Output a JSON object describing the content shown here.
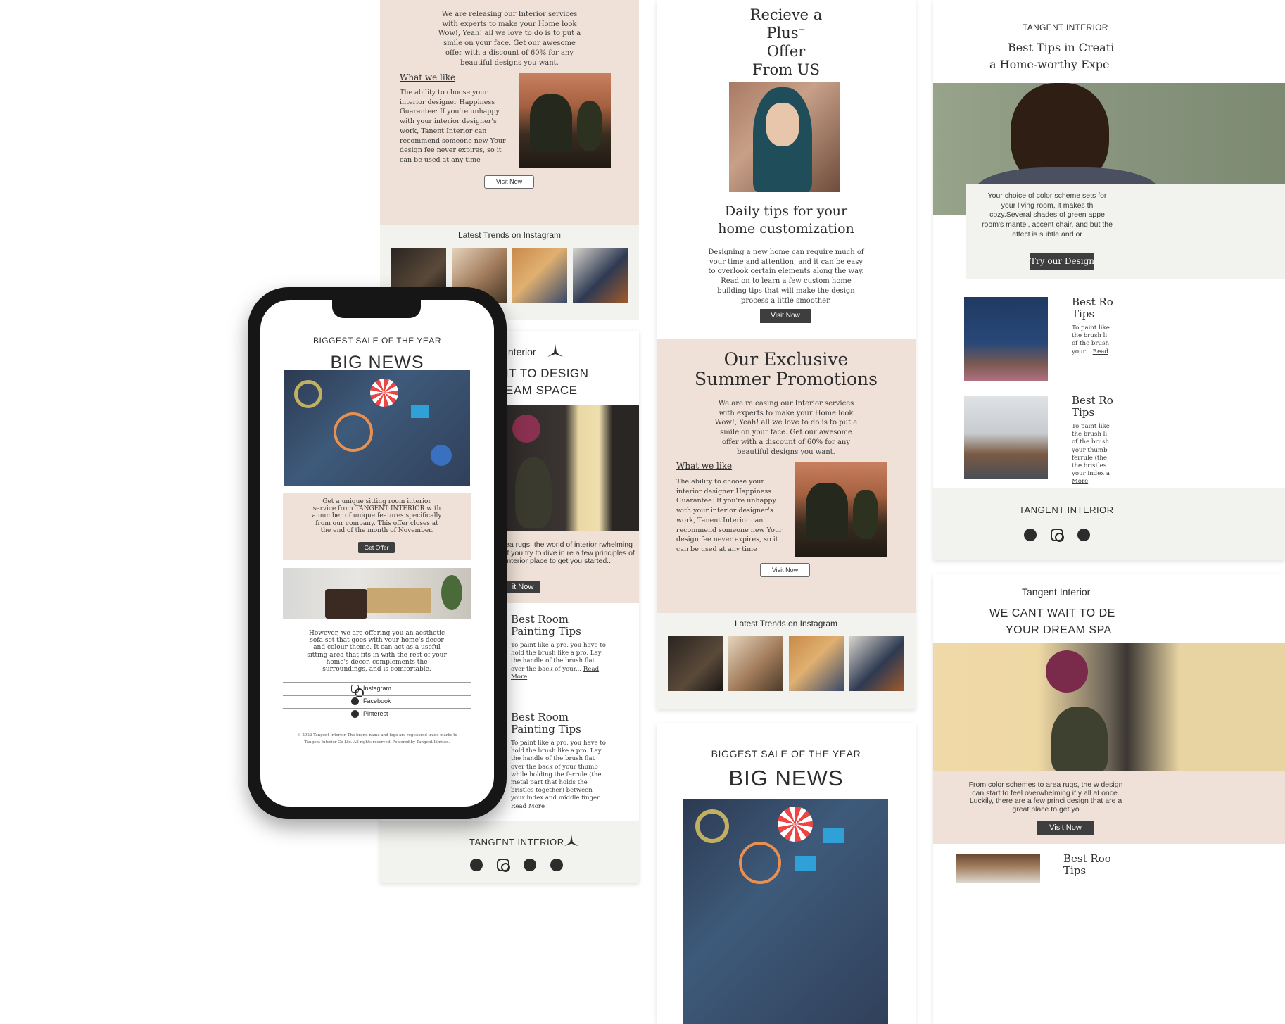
{
  "card1": {
    "intro": "We are releasing our Interior services with experts to make your Home look Wow!, Yeah! all we love to do is to put a smile on your face. Get our awesome offer with a discount of 60% for any beautiful designs you want.",
    "what_we_like": "What we like",
    "what_we_like_body": "The ability to choose your interior designer Happiness Guarantee: If you're unhappy with your interior designer's work, Tanent Interior can recommend someone new Your design fee never expires, so it can be used at any time",
    "visit_now": "Visit Now",
    "instagram_title": "Latest Trends on Instagram"
  },
  "card2": {
    "brand": "Interior",
    "headline_1": "IT TO DESIGN",
    "headline_2": "EAM SPACE",
    "body": "ea rugs, the world of interior rwhelming if you try to dive in re a few principles of interior place to get you started...",
    "cta": "it Now",
    "article1_title": "Best Room Painting Tips",
    "article1_body": "To paint like a pro, you have to hold the brush like a pro. Lay the handle of the brush flat over the back of your...",
    "article1_link": "Read More",
    "article2_title": "Best Room Painting Tips",
    "article2_body": "To paint like a pro, you have to hold the brush like a pro. Lay the handle of the brush flat over the back of your thumb while holding the ferrule (the metal part that holds the bristles together) between your index and middle finger.",
    "article2_link": "Read More",
    "footer_brand": "TANGENT INTERIOR"
  },
  "card3": {
    "headline_1": "Recieve a",
    "headline_2": "Plus",
    "headline_plus": "+",
    "headline_3": "Offer",
    "headline_4": "From US",
    "tips_title_1": "Daily tips for your",
    "tips_title_2": "home customization",
    "tips_body": "Designing a new home can require much of your time and attention, and it can be easy to overlook certain elements along the way. Read on to learn a few custom home building tips that will make the design process a little smoother.",
    "visit_now": "Visit Now",
    "promo_title_1": "Our Exclusive",
    "promo_title_2": "Summer Promotions",
    "promo_body": "We are releasing our Interior services with experts to make your Home look Wow!, Yeah! all we love to do is to put a smile on your face. Get our awesome offer with a discount of 60% for any beautiful designs you want.",
    "what_we_like": "What we like",
    "what_we_like_body": "The ability to choose your interior designer Happiness Guarantee: If you're unhappy with your interior designer's work, Tanent Interior can recommend someone new Your design fee never expires, so it can be used at any time",
    "visit_now_2": "Visit Now",
    "instagram_title": "Latest Trends on Instagram"
  },
  "card4": {
    "eyebrow": "BIGGEST SALE OF THE YEAR",
    "title": "BIG NEWS"
  },
  "card5": {
    "brand": "TANGENT INTERIOR",
    "title_1": "Best Tips in Creati",
    "title_2": "a Home-worthy Expe",
    "body": "Your choice of color scheme sets for your living room, it makes th cozy.Several shades of green appe room's mantel, accent chair, and but the effect is subtle and or",
    "cta": "Try our Design",
    "article1_title": "Best Ro Tips",
    "article1_body": "To paint like the brush li of the brush your...",
    "article1_link": "Read",
    "article2_title": "Best Ro Tips",
    "article2_body": "To paint like the brush li of the brush your thumb ferrule (the the bristles your index a",
    "article2_link": "More",
    "footer_brand": "TANGENT INTERIOR"
  },
  "card6": {
    "brand": "Tangent Interior",
    "headline_1": "WE CANT WAIT TO DE",
    "headline_2": "YOUR DREAM SPA",
    "body": "From color schemes to area rugs, the w design can start to feel overwhelming if y all at once. Luckily, there are a few princi design that are a great place to get yo",
    "cta": "Visit Now",
    "article_title": "Best Roo Tips"
  },
  "phone": {
    "eyebrow": "BIGGEST SALE OF THE YEAR",
    "title": "BIG NEWS",
    "offer_body": "Get a unique sitting room interior service from TANGENT INTERIOR with a number of unique features specifically from our company. This offer closes at the end of the month of November.",
    "offer_cta": "Get Offer",
    "sofa_body": "However, we are offering you an aesthetic sofa set that goes with your home's decor and colour theme. It can act as a useful sitting area that fits in with the rest of your home's decor, complements the surroundings, and is comfortable.",
    "social_instagram": "Instagram",
    "social_facebook": "Facebook",
    "social_pinterest": "Pinterest",
    "legal": "© 2022 Tangent Interior. The brand name and logo are registered trade marks to Tangent Interior Co Ltd. All rights reserved. Powered by Tangent Limited."
  },
  "colors": {
    "peach": "#efe1d7",
    "grey": "#f2f2ee",
    "dark_button": "#3e3e3e"
  }
}
